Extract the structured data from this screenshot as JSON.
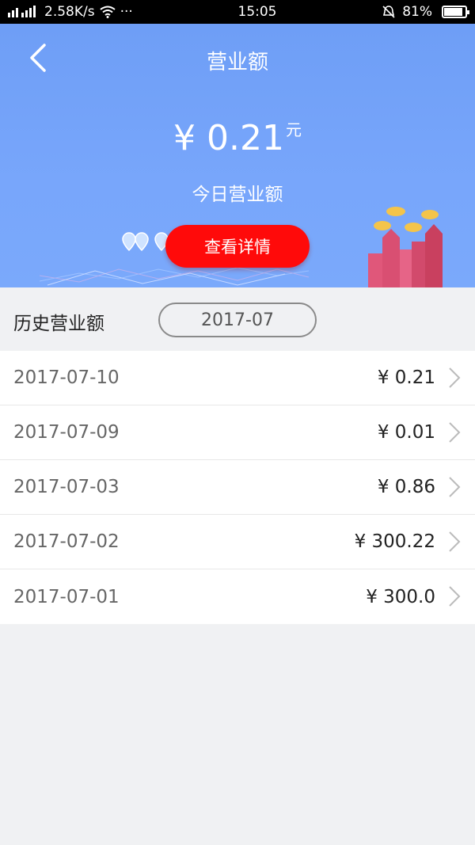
{
  "status_bar": {
    "speed": "2.58K/s",
    "dots": "···",
    "time": "15:05",
    "battery": "81%"
  },
  "header": {
    "title": "营业额",
    "amount": "¥ 0.21",
    "unit": "元",
    "subtitle": "今日营业额",
    "detail_button": "查看详情"
  },
  "history": {
    "label": "历史营业额",
    "month": "2017-07",
    "rows": [
      {
        "date": "2017-07-10",
        "amount": "¥ 0.21"
      },
      {
        "date": "2017-07-09",
        "amount": "¥ 0.01"
      },
      {
        "date": "2017-07-03",
        "amount": "¥ 0.86"
      },
      {
        "date": "2017-07-02",
        "amount": "¥ 300.22"
      },
      {
        "date": "2017-07-01",
        "amount": "¥ 300.0"
      }
    ]
  },
  "icons": {
    "back": "chevron-left-icon",
    "row_arrow": "chevron-right-icon",
    "battery": "battery-icon",
    "wifi": "wifi-icon",
    "mute": "bell-muted-icon"
  },
  "colors": {
    "header_bg": "#78a6fb",
    "button_bg": "#ff0a0a"
  }
}
